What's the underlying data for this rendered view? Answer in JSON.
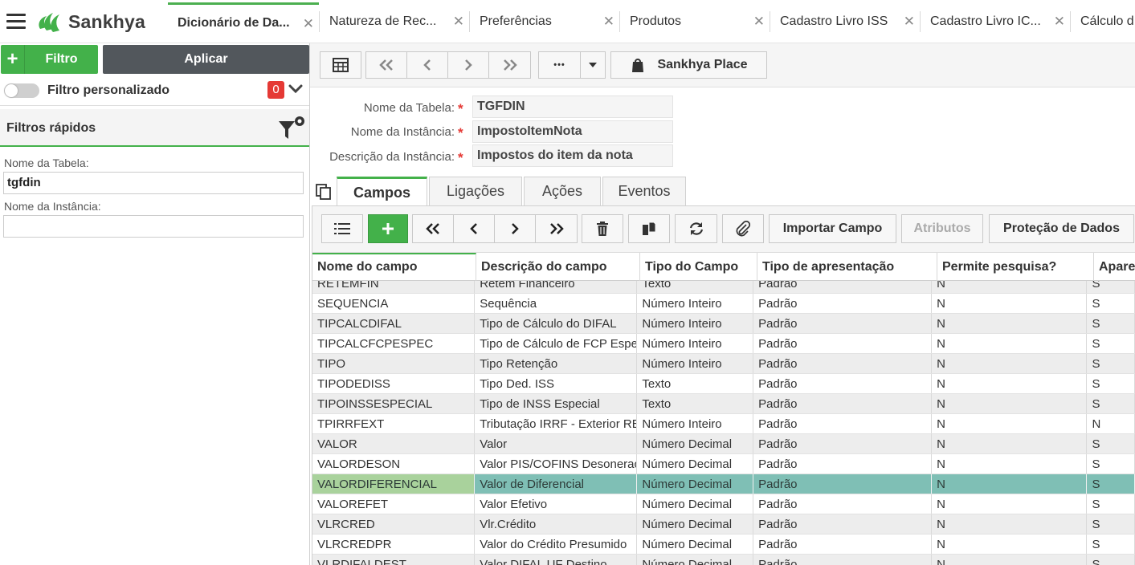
{
  "app": {
    "logo_text": "Sankhya",
    "brand_color": "#43b14a"
  },
  "tabs": [
    {
      "label": "Dicionário de Da...",
      "active": true
    },
    {
      "label": "Natureza de Rec..."
    },
    {
      "label": "Preferências"
    },
    {
      "label": "Produtos"
    },
    {
      "label": "Cadastro Livro ISS"
    },
    {
      "label": "Cadastro Livro IC..."
    },
    {
      "label": "Cálculo d"
    }
  ],
  "left": {
    "filter_button": "Filtro",
    "apply_button": "Aplicar",
    "custom_filter_label": "Filtro personalizado",
    "custom_filter_count": "0",
    "quick_filters_title": "Filtros rápidos",
    "fields": [
      {
        "label": "Nome da Tabela:",
        "value": "tgfdin"
      },
      {
        "label": "Nome da Instância:",
        "value": ""
      }
    ]
  },
  "toolbar": {
    "more_label": "•••",
    "place_label": "Sankhya Place"
  },
  "form": {
    "fields": [
      {
        "label": "Nome da Tabela:",
        "required": "*",
        "value": "TGFDIN"
      },
      {
        "label": "Nome da Instância:",
        "required": "*",
        "value": "ImpostoItemNota"
      },
      {
        "label": "Descrição da Instância:",
        "required": "*",
        "value": "Impostos do item da nota"
      }
    ]
  },
  "subtabs": [
    {
      "label": "Campos",
      "active": true
    },
    {
      "label": "Ligações"
    },
    {
      "label": "Ações"
    },
    {
      "label": "Eventos"
    }
  ],
  "grid_toolbar": {
    "import_label": "Importar Campo",
    "attributes_label": "Atributos",
    "protection_label": "Proteção de Dados"
  },
  "grid": {
    "columns": [
      "Nome do campo",
      "Descrição do campo",
      "Tipo do Campo",
      "Tipo de apresentação",
      "Permite pesquisa?",
      "Aparece"
    ],
    "rows": [
      [
        "RETEMFIN",
        "Retém Financeiro",
        "Texto",
        "Padrão",
        "N",
        "S"
      ],
      [
        "SEQUENCIA",
        "Sequência",
        "Número Inteiro",
        "Padrão",
        "N",
        "S"
      ],
      [
        "TIPCALCDIFAL",
        "Tipo de Cálculo do DIFAL",
        "Número Inteiro",
        "Padrão",
        "N",
        "S"
      ],
      [
        "TIPCALCFCPESPEC",
        "Tipo de Cálculo de FCP Espe",
        "Número Inteiro",
        "Padrão",
        "N",
        "S"
      ],
      [
        "TIPO",
        "Tipo Retenção",
        "Número Inteiro",
        "Padrão",
        "N",
        "S"
      ],
      [
        "TIPODEDISS",
        "Tipo Ded. ISS",
        "Texto",
        "Padrão",
        "N",
        "S"
      ],
      [
        "TIPOINSSESPECIAL",
        "Tipo de INSS Especial",
        "Texto",
        "Padrão",
        "N",
        "S"
      ],
      [
        "TPIRRFEXT",
        "Tributação IRRF - Exterior RE",
        "Número Inteiro",
        "Padrão",
        "N",
        "N"
      ],
      [
        "VALOR",
        "Valor",
        "Número Decimal",
        "Padrão",
        "N",
        "S"
      ],
      [
        "VALORDESON",
        "Valor PIS/COFINS Desonerac",
        "Número Decimal",
        "Padrão",
        "N",
        "S"
      ],
      [
        "VALORDIFERENCIAL",
        "Valor de Diferencial",
        "Número Decimal",
        "Padrão",
        "N",
        "S"
      ],
      [
        "VALOREFET",
        "Valor Efetivo",
        "Número Decimal",
        "Padrão",
        "N",
        "S"
      ],
      [
        "VLRCRED",
        "Vlr.Crédito",
        "Número Decimal",
        "Padrão",
        "N",
        "S"
      ],
      [
        "VLRCREDPR",
        "Valor do Crédito Presumido",
        "Número Decimal",
        "Padrão",
        "N",
        "S"
      ],
      [
        "VLRDIFALDEST",
        "Valor DIFAL UF Destino",
        "Número Decimal",
        "Padrão",
        "N",
        "S"
      ]
    ],
    "selected_row": 10
  }
}
